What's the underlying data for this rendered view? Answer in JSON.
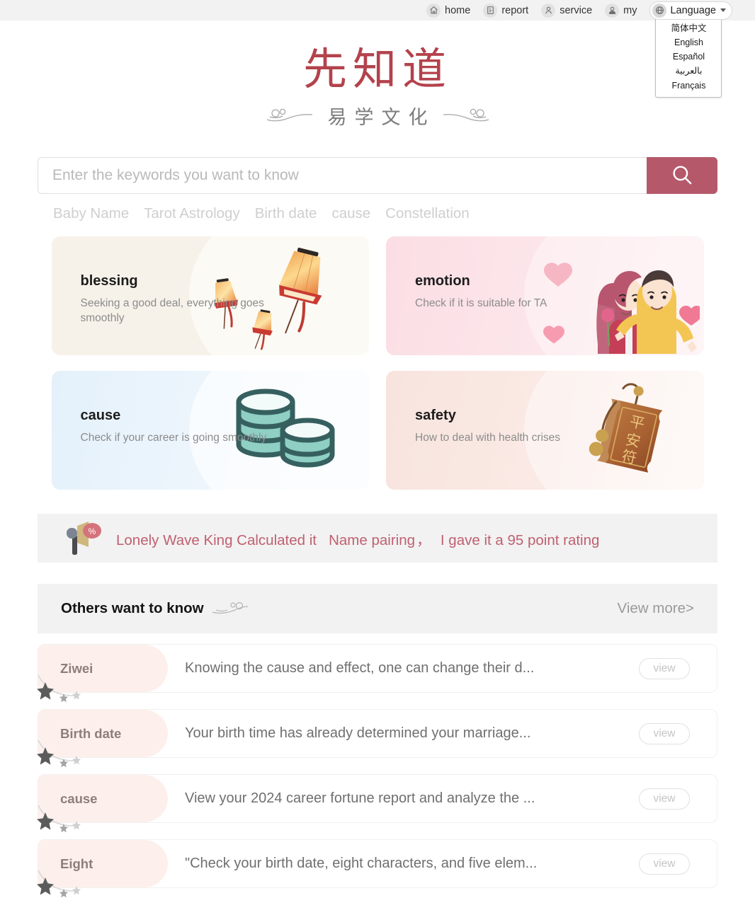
{
  "topnav": {
    "items": [
      {
        "label": "home",
        "icon": "home-icon"
      },
      {
        "label": "report",
        "icon": "report-icon"
      },
      {
        "label": "service",
        "icon": "service-icon"
      },
      {
        "label": "my",
        "icon": "user-icon"
      }
    ],
    "language": {
      "label": "Language",
      "icon": "globe-icon",
      "options": [
        "简体中文",
        "English",
        "Español",
        "بالعربية",
        "Français"
      ]
    }
  },
  "logo": {
    "main": "先知道",
    "sub": "易学文化",
    "main_color": "#b3424c",
    "sub_color": "#7c7c7c"
  },
  "search": {
    "value": "",
    "placeholder": "Enter the keywords you want to know",
    "button_icon": "search-icon",
    "button_color": "#b5596a",
    "tags": [
      "Baby Name",
      "Tarot Astrology",
      "Birth date",
      "cause",
      "Constellation"
    ]
  },
  "cards": [
    {
      "title": "blessing",
      "desc": "Seeking a good deal, everything goes smoothly",
      "art": "sky-lanterns-illustration",
      "bg": "#f7f2e9"
    },
    {
      "title": "emotion",
      "desc": "Check if it is suitable for TA",
      "art": "couple-hug-illustration",
      "bg": "#fbdee4"
    },
    {
      "title": "cause",
      "desc": "Check if your career is going smoothly",
      "art": "coin-stacks-illustration",
      "bg": "#e4f1fb"
    },
    {
      "title": "safety",
      "desc": "How to deal with health crises",
      "art": "peace-amulet-illustration",
      "bg": "#f8e4de"
    }
  ],
  "announcement": {
    "icon": "megaphone-percent-icon",
    "part1": "Lonely Wave King Calculated it",
    "part2": "Name pairing",
    "separator": "，",
    "part3": "I gave it a 95 point rating",
    "color": "#c06070"
  },
  "section": {
    "title": "Others want to know",
    "ornament": "cloud-ornament-icon",
    "view_more": "View more",
    "view_more_chevron": ">"
  },
  "list": {
    "view_label": "view",
    "rows": [
      {
        "tag": "Ziwei",
        "desc": "Knowing the cause and effect, one can change their d..."
      },
      {
        "tag": "Birth date",
        "desc": "Your birth time has already determined your marriage..."
      },
      {
        "tag": "cause",
        "desc": "View your 2024 career fortune report and analyze the ..."
      },
      {
        "tag": "Eight",
        "desc": "\"Check your birth date, eight characters, and five elem..."
      }
    ]
  }
}
